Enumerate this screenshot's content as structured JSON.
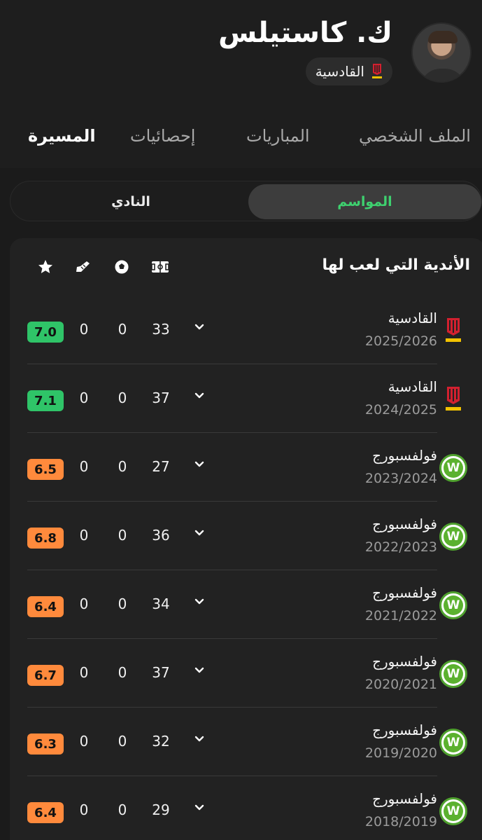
{
  "player": {
    "name": "ك. كاستيلس",
    "club": "القادسية"
  },
  "tabs": [
    {
      "label": "الملف الشخصي",
      "active": false
    },
    {
      "label": "المباريات",
      "active": false
    },
    {
      "label": "إحصائيات",
      "active": false
    },
    {
      "label": "المسيرة",
      "active": true
    }
  ],
  "segment": {
    "seasons_label": "المواسم",
    "club_label": "النادي",
    "selected": "المواسم"
  },
  "card": {
    "title": "الأندية التي لعب لها",
    "columns": [
      "appearances-icon",
      "goals-icon",
      "assists-icon",
      "rating-star-icon"
    ]
  },
  "colors": {
    "accent_green": "#3ed16f",
    "rating_green": "#2fc468",
    "rating_orange": "#ff8a3c",
    "qadsiah_red": "#d2202f",
    "qadsiah_yellow": "#f2c200",
    "wolfsburg_green": "#5bb12f"
  },
  "rows": [
    {
      "club": "القادسية",
      "season": "2025/2026",
      "apps": "33",
      "goals": "0",
      "assists": "0",
      "rating": "7.0",
      "rating_color": "#2fc468",
      "logo": "qadsiah-logo"
    },
    {
      "club": "القادسية",
      "season": "2024/2025",
      "apps": "37",
      "goals": "0",
      "assists": "0",
      "rating": "7.1",
      "rating_color": "#2fc468",
      "logo": "qadsiah-logo"
    },
    {
      "club": "فولفسبورج",
      "season": "2023/2024",
      "apps": "27",
      "goals": "0",
      "assists": "0",
      "rating": "6.5",
      "rating_color": "#ff8a3c",
      "logo": "wolfsburg-logo"
    },
    {
      "club": "فولفسبورج",
      "season": "2022/2023",
      "apps": "36",
      "goals": "0",
      "assists": "0",
      "rating": "6.8",
      "rating_color": "#ff8a3c",
      "logo": "wolfsburg-logo"
    },
    {
      "club": "فولفسبورج",
      "season": "2021/2022",
      "apps": "34",
      "goals": "0",
      "assists": "0",
      "rating": "6.4",
      "rating_color": "#ff8a3c",
      "logo": "wolfsburg-logo"
    },
    {
      "club": "فولفسبورج",
      "season": "2020/2021",
      "apps": "37",
      "goals": "0",
      "assists": "0",
      "rating": "6.7",
      "rating_color": "#ff8a3c",
      "logo": "wolfsburg-logo"
    },
    {
      "club": "فولفسبورج",
      "season": "2019/2020",
      "apps": "32",
      "goals": "0",
      "assists": "0",
      "rating": "6.3",
      "rating_color": "#ff8a3c",
      "logo": "wolfsburg-logo"
    },
    {
      "club": "فولفسبورج",
      "season": "2018/2019",
      "apps": "29",
      "goals": "0",
      "assists": "0",
      "rating": "6.4",
      "rating_color": "#ff8a3c",
      "logo": "wolfsburg-logo"
    }
  ]
}
